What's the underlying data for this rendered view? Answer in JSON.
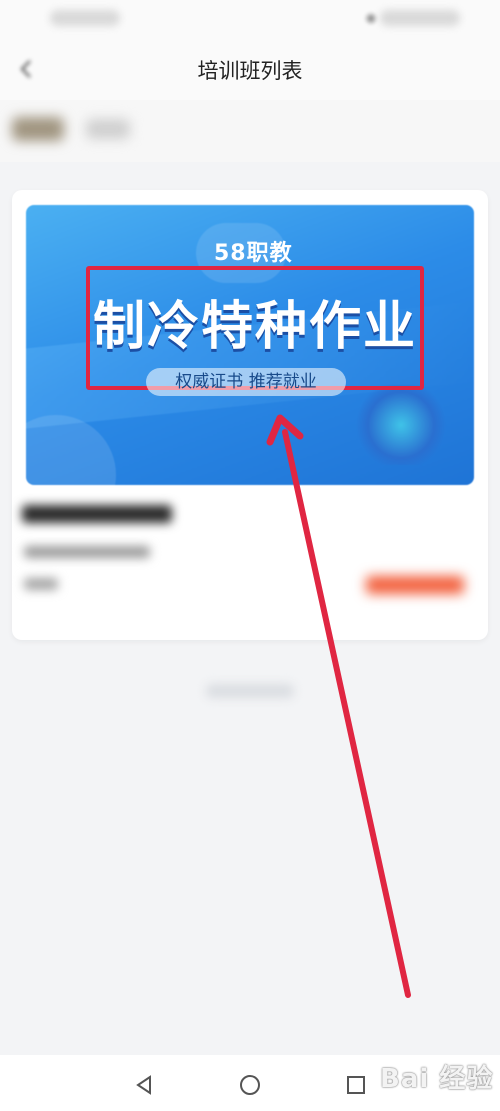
{
  "nav": {
    "title": "培训班列表"
  },
  "banner": {
    "brand": "58职教",
    "headline": "制冷特种作业",
    "slogan": "权威证书 推荐就业"
  },
  "bottom_nav": {
    "back_icon": "triangle-back-icon",
    "home_icon": "circle-home-icon",
    "recent_icon": "square-recent-icon"
  },
  "watermark": {
    "text": "Bai 经验"
  },
  "colors": {
    "highlight_red": "#e02642",
    "banner_blue": "#2c8ce8",
    "price_orange": "#f2603d"
  }
}
